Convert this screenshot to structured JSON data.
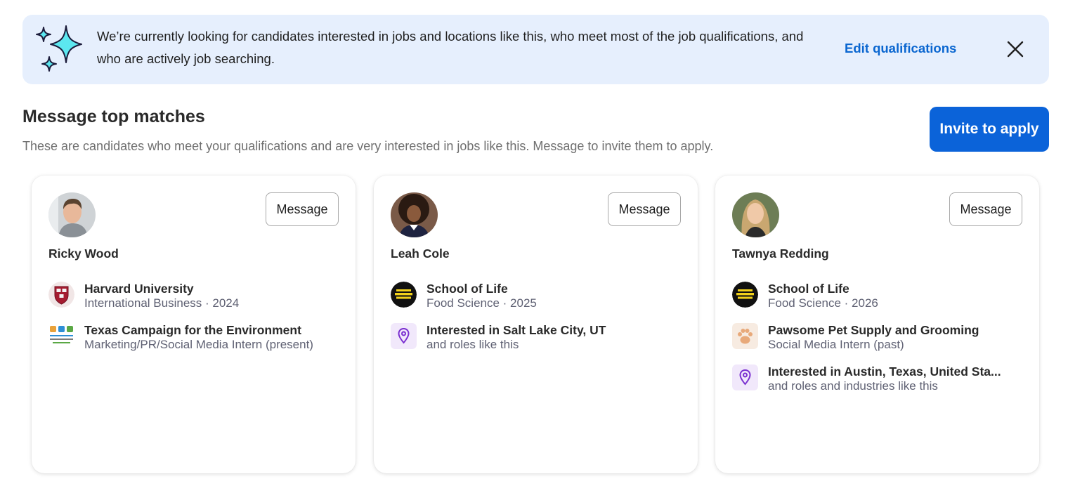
{
  "banner": {
    "text": "We’re currently looking for candidates interested in jobs and locations like this, who meet most of the job qualifications, and who are actively job searching.",
    "edit_link": "Edit qualifications",
    "accent_color": "#0a66d0",
    "background": "#e6effd",
    "icons": [
      "sparkle-icon",
      "close-icon"
    ]
  },
  "section": {
    "title": "Message top matches",
    "subtitle": "These are candidates who meet your qualifications and are very interested in jobs like this. Message to invite them to apply.",
    "invite_button": "Invite to apply",
    "invite_color": "#0b63d9"
  },
  "candidates": [
    {
      "name": "Ricky Wood",
      "message_label": "Message",
      "details": [
        {
          "icon": "harvard-crest-icon",
          "title": "Harvard University",
          "subtitle": "International Business · 2024"
        },
        {
          "icon": "texas-campaign-logo-icon",
          "title": "Texas Campaign for the Environment",
          "subtitle": "Marketing/PR/Social Media Intern (present)"
        }
      ]
    },
    {
      "name": "Leah Cole",
      "message_label": "Message",
      "details": [
        {
          "icon": "school-of-life-logo-icon",
          "title": "School of Life",
          "subtitle": "Food Science · 2025"
        },
        {
          "icon": "location-pin-icon",
          "title": "Interested in Salt Lake City, UT",
          "subtitle": "and roles like this"
        }
      ]
    },
    {
      "name": "Tawnya Redding",
      "message_label": "Message",
      "details": [
        {
          "icon": "school-of-life-logo-icon",
          "title": "School of Life",
          "subtitle": "Food Science · 2026"
        },
        {
          "icon": "paw-print-icon",
          "title": "Pawsome Pet Supply and Grooming",
          "subtitle": "Social Media Intern (past)"
        },
        {
          "icon": "location-pin-icon",
          "title": "Interested in Austin, Texas, United Sta...",
          "subtitle": "and roles and industries like this"
        }
      ]
    }
  ]
}
